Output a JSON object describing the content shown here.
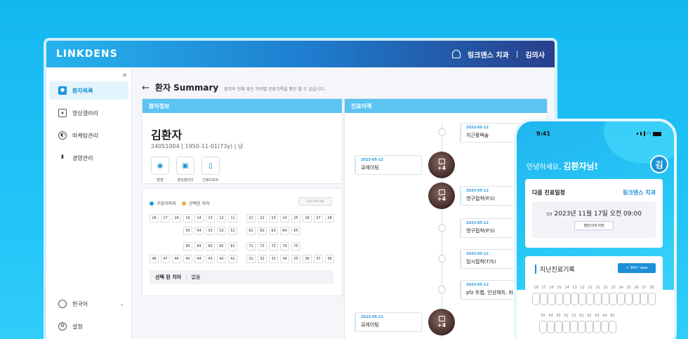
{
  "app": {
    "logo": "LINKDENS",
    "clinic": "링크덴스 치과",
    "separator": "|",
    "user": "김의사"
  },
  "sidebar": {
    "collapse": "«",
    "items": [
      {
        "label": "환자목록",
        "icon": "user-icon"
      },
      {
        "label": "영상갤러리",
        "icon": "image-icon"
      },
      {
        "label": "마케팅관리",
        "icon": "megaphone-icon"
      },
      {
        "label": "경영관리",
        "icon": "bar-chart-icon"
      }
    ],
    "language": "한국어",
    "settings": "설정"
  },
  "header": {
    "back": "←",
    "title": "환자 Summary",
    "subtitle": "환자의 전체 혹은 치아별 진료기록을 확인 할 수 있습니다."
  },
  "patient": {
    "panel_title": "환자정보",
    "name": "김환자",
    "meta": "24051004  |  1950-11-01(73y)  |  남",
    "actions": [
      {
        "label": "촬영",
        "icon": "camera-icon"
      },
      {
        "label": "영상갤러리",
        "icon": "image-icon"
      },
      {
        "label": "진료리포트",
        "icon": "clipboard-icon"
      }
    ]
  },
  "chart": {
    "legend": [
      {
        "label": "구강이미지",
        "color": "#1a9ae0"
      },
      {
        "label": "선택된 치아",
        "color": "#e8b04a"
      }
    ],
    "reset_label": "전체 선택 해제",
    "rows": [
      [
        "18",
        "17",
        "16",
        "15",
        "14",
        "13",
        "12",
        "11",
        "21",
        "22",
        "23",
        "24",
        "25",
        "26",
        "27",
        "28"
      ],
      [
        "55",
        "54",
        "53",
        "52",
        "51",
        "61",
        "62",
        "63",
        "64",
        "65"
      ],
      [
        "85",
        "84",
        "83",
        "82",
        "81",
        "71",
        "72",
        "73",
        "74",
        "75"
      ],
      [
        "48",
        "47",
        "46",
        "45",
        "44",
        "43",
        "42",
        "41",
        "31",
        "32",
        "33",
        "34",
        "35",
        "36",
        "37",
        "38"
      ]
    ],
    "selected_label": "선택 된 치아",
    "selected_value": "없음"
  },
  "history": {
    "panel_title": "진료이력",
    "entries": [
      {
        "date": "2023-05-12",
        "title": "치근활택술",
        "side": "right"
      },
      {
        "date": "2023-05-12",
        "title": "큐레이팅",
        "side": "left",
        "more": "+4"
      },
      {
        "date": "2023-05-12",
        "title": "영구접착(P.S)",
        "side": "right",
        "more": "+4"
      },
      {
        "date": "2023-05-12",
        "title": "영구접착(P.S)",
        "side": "right"
      },
      {
        "date": "2023-05-12",
        "title": "임시접착(T/S)",
        "side": "right"
      },
      {
        "date": "2023-05-12",
        "title": "pfz 프렙, 인상채득, 바",
        "side": "right"
      },
      {
        "date": "2023-05-12",
        "title": "큐레이팅",
        "side": "left",
        "more": "+4"
      }
    ]
  },
  "phone": {
    "time": "9:41",
    "greeting": "안녕하세요, ",
    "user": "김환자님!",
    "avatar": "김",
    "appt_label": "다음 진료일정",
    "appt_clinic": "링크덴스 치과",
    "appt_date": "2023년 11월 17일 오전 09:00",
    "calendar_btn": "캘린더에 저장",
    "history_label": "지난진료기록",
    "view_btn": "+ 360° view",
    "upper_nums": [
      "18",
      "17",
      "16",
      "15",
      "14",
      "13",
      "12",
      "11",
      "21",
      "22",
      "23",
      "24",
      "25",
      "26",
      "27",
      "28"
    ],
    "lower_nums": [
      "55",
      "54",
      "53",
      "52",
      "51",
      "61",
      "62",
      "63",
      "64",
      "65"
    ]
  }
}
